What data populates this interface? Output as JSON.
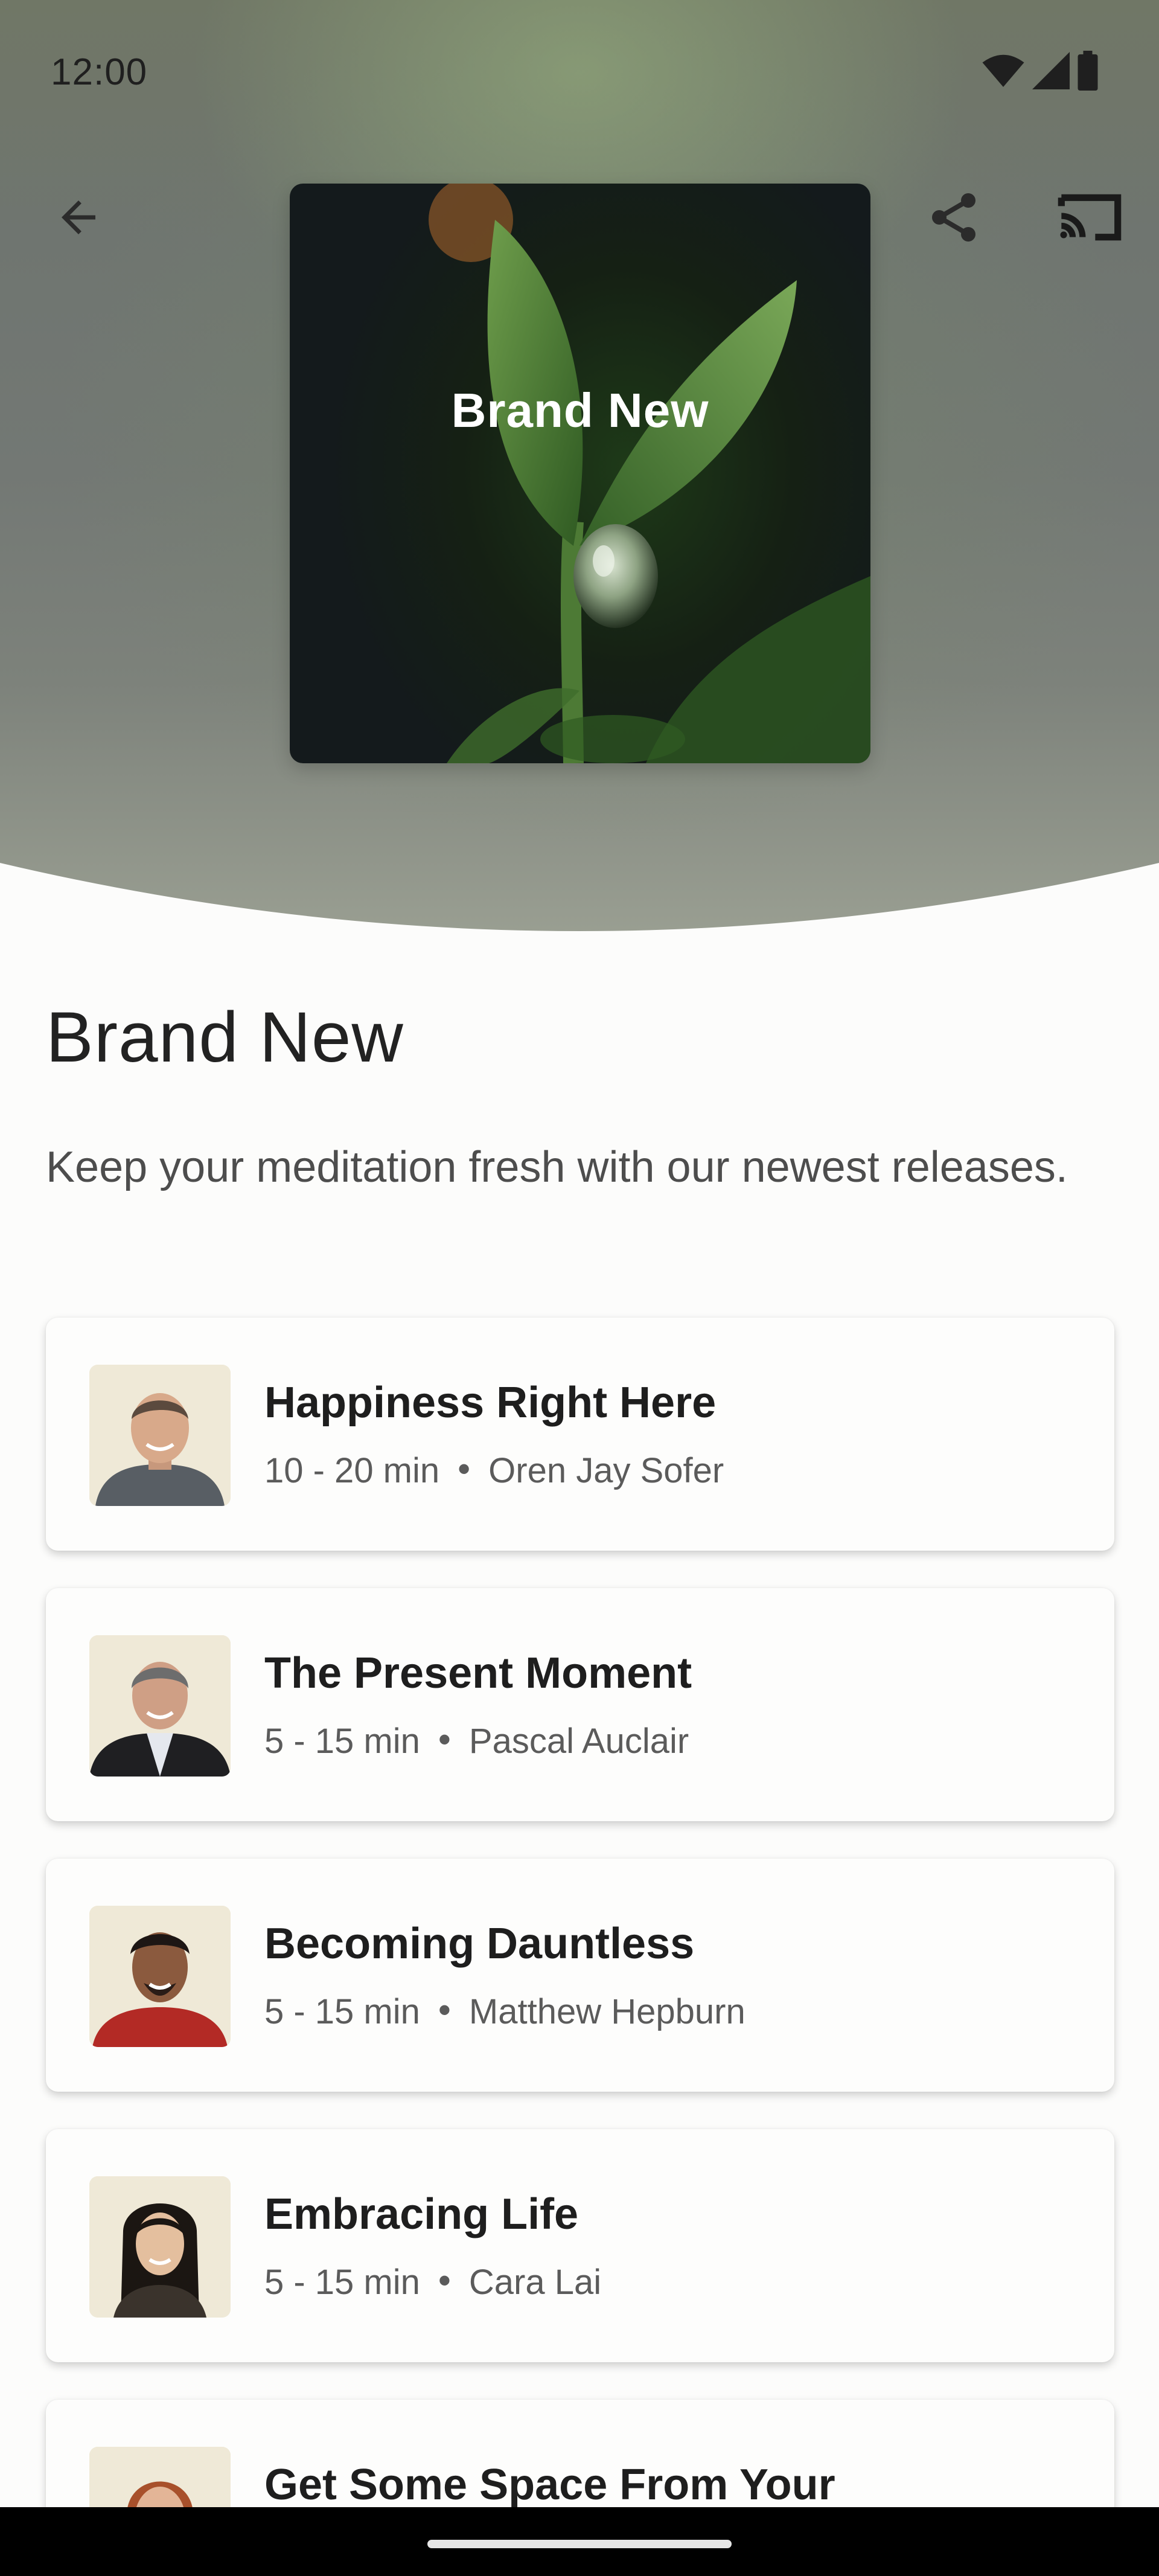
{
  "status_bar": {
    "time": "12:00",
    "icons": [
      "wifi-icon",
      "signal-icon",
      "battery-icon"
    ]
  },
  "toolbar": {
    "back_icon": "arrow-left-icon",
    "share_icon": "share-icon",
    "cast_icon": "cast-icon"
  },
  "artwork": {
    "title": "Brand New",
    "image": "green-sprout-with-water-drop"
  },
  "collection": {
    "title": "Brand New",
    "description": "Keep your meditation fresh with our newest releases."
  },
  "items": [
    {
      "title": "Happiness Right Here",
      "duration": "10 - 20 min",
      "teacher": "Oren Jay Sofer"
    },
    {
      "title": "The Present Moment",
      "duration": "5 - 15 min",
      "teacher": "Pascal Auclair"
    },
    {
      "title": "Becoming Dauntless",
      "duration": "5 - 15 min",
      "teacher": "Matthew Hepburn"
    },
    {
      "title": "Embracing Life",
      "duration": "5 - 15 min",
      "teacher": "Cara Lai"
    },
    {
      "title": "Get Some Space From Your",
      "duration": "",
      "teacher": ""
    }
  ],
  "colors": {
    "background": "#fcfcfb",
    "text_primary": "#1e1e1e",
    "text_secondary": "#5b5b5b",
    "art_title": "#ffffff"
  }
}
